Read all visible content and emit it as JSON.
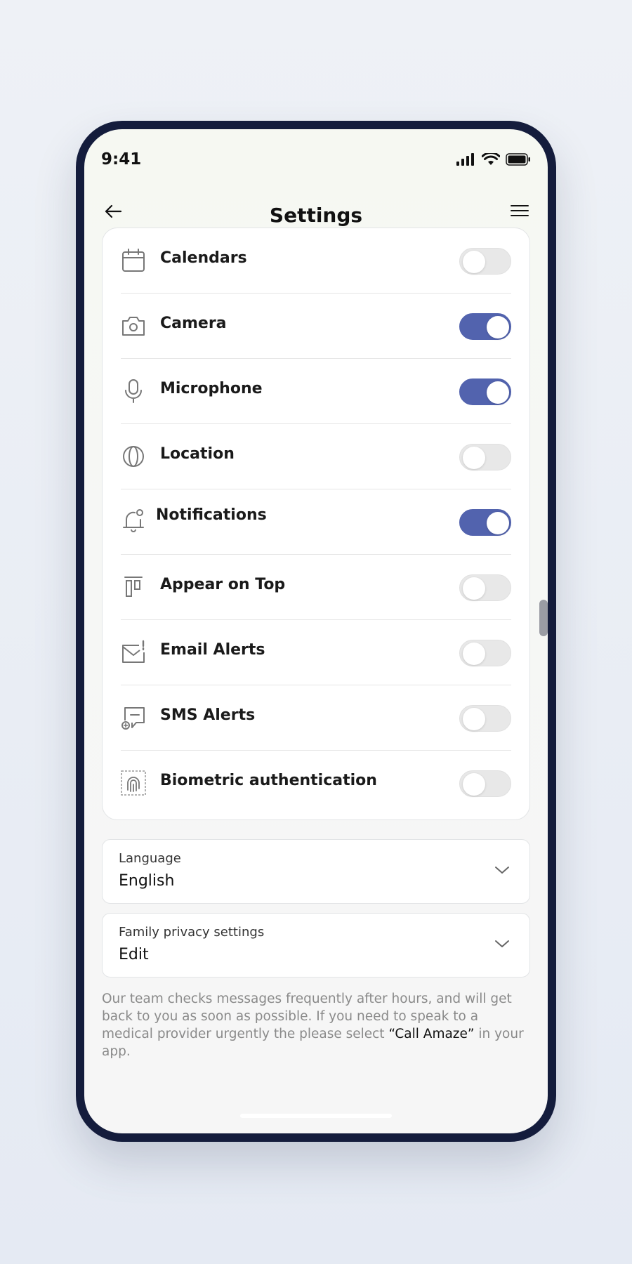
{
  "status_bar": {
    "time": "9:41"
  },
  "header": {
    "title": "Settings"
  },
  "permissions": [
    {
      "label": "Calendars",
      "icon": "calendar-icon",
      "enabled": false
    },
    {
      "label": "Camera",
      "icon": "camera-icon",
      "enabled": true
    },
    {
      "label": "Microphone",
      "icon": "microphone-icon",
      "enabled": true
    },
    {
      "label": "Location",
      "icon": "globe-icon",
      "enabled": false
    },
    {
      "label": "Notifications",
      "icon": "bell-icon",
      "enabled": true
    },
    {
      "label": "Appear on Top",
      "icon": "layers-icon",
      "enabled": false
    },
    {
      "label": "Email Alerts",
      "icon": "email-icon",
      "enabled": false
    },
    {
      "label": "SMS Alerts",
      "icon": "sms-icon",
      "enabled": false
    },
    {
      "label": "Biometric authentication",
      "icon": "fingerprint-icon",
      "enabled": false
    }
  ],
  "language": {
    "label": "Language",
    "value": "English"
  },
  "family_privacy": {
    "label": "Family privacy settings",
    "value": "Edit"
  },
  "footer": {
    "text_before": "Our team checks messages frequently after hours, and will get back to you as soon as possible. If you need to speak to a medical provider urgently the please select ",
    "highlight": "“Call Amaze”",
    "text_after": " in your app."
  },
  "colors": {
    "accent": "#5263ae",
    "toggle_off": "#e8e8e8",
    "frame": "#141c3c"
  }
}
